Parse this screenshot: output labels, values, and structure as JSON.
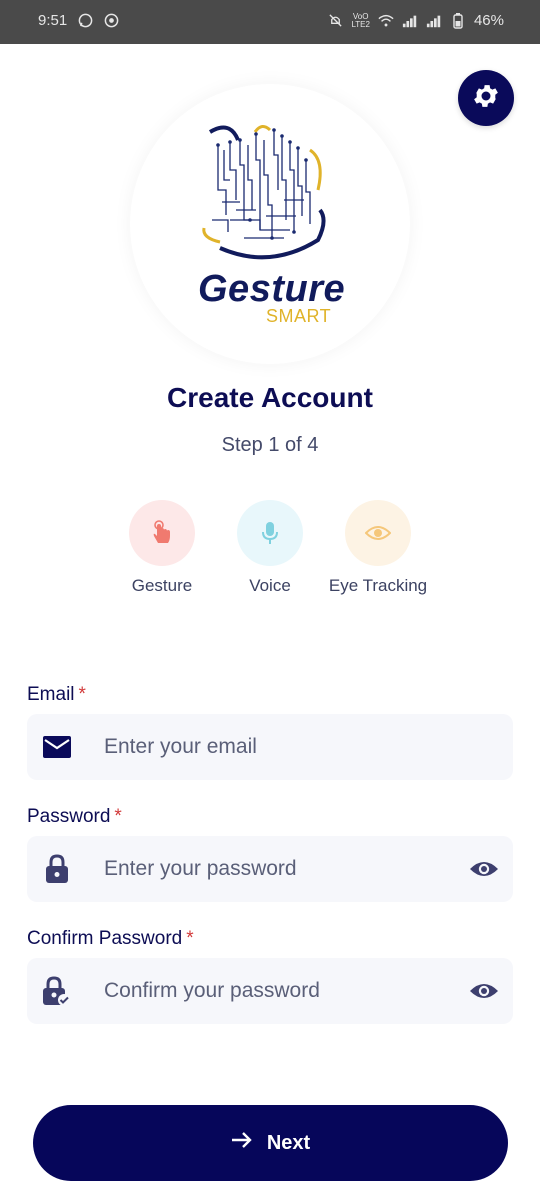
{
  "status_bar": {
    "time": "9:51",
    "net_type_top": "VoO",
    "net_type_bottom": "LTE2",
    "battery": "46%"
  },
  "logo": {
    "main": "Gesture",
    "sub": "SMART"
  },
  "header": {
    "title": "Create Account",
    "step": "Step 1 of 4"
  },
  "modes": [
    {
      "label": "Gesture",
      "icon": "hand-pointer-icon",
      "bg": "#fde8e8",
      "color": "#f07a6f"
    },
    {
      "label": "Voice",
      "icon": "microphone-icon",
      "bg": "#e8f7fb",
      "color": "#7fd1df"
    },
    {
      "label": "Eye Tracking",
      "icon": "eye-icon",
      "bg": "#fdf3e4",
      "color": "#f5c77a"
    }
  ],
  "form": {
    "email": {
      "label": "Email",
      "required": "*",
      "placeholder": "Enter your email"
    },
    "password": {
      "label": "Password",
      "required": "*",
      "placeholder": "Enter your password"
    },
    "confirm": {
      "label": "Confirm Password",
      "required": "*",
      "placeholder": "Confirm your password"
    }
  },
  "next_button": {
    "label": "Next"
  },
  "colors": {
    "primary": "#06065a",
    "accent": "#e0b32a",
    "required": "#d23a3a"
  }
}
